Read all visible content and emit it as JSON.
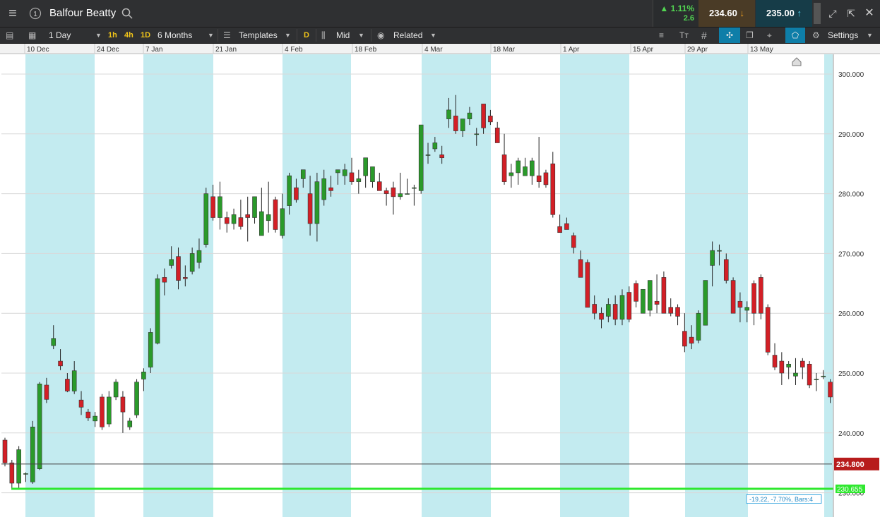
{
  "window": {
    "instrument_title": "Balfour Beatty"
  },
  "quote": {
    "change_pct": "▲ 1.11%",
    "change_pts": "2.6",
    "sell_price": "234.60",
    "buy_price": "235.00"
  },
  "toolbar": {
    "interval": "1 Day",
    "quick_1h": "1h",
    "quick_4h": "4h",
    "quick_1d": "1D",
    "range": "6 Months",
    "templates": "Templates",
    "mode_d": "D",
    "price_type": "Mid",
    "related": "Related",
    "settings": "Settings"
  },
  "colors": {
    "up": "#2a9a2a",
    "down": "#d31f26",
    "shade": "#c3ebf0",
    "current_price_label": "#b71c1c",
    "support_line": "#2ee82e"
  },
  "chart_data": {
    "type": "candlestick",
    "title": "",
    "y_ticks": [
      "300.000",
      "290.000",
      "280.000",
      "270.000",
      "260.000",
      "250.000",
      "240.000",
      "230.000"
    ],
    "ylim": [
      228.5,
      303
    ],
    "x_labels": [
      "10 Dec",
      "24 Dec",
      "7 Jan",
      "21 Jan",
      "4 Feb",
      "18 Feb",
      "4 Mar",
      "18 Mar",
      "1 Apr",
      "15 Apr",
      "29 Apr",
      "13 May"
    ],
    "current_price_label": "234.800",
    "current_price": 234.8,
    "support_label": "230.655",
    "support_value": 230.655,
    "measure_label": "-19.22, -7.70%, Bars:4",
    "measure": {
      "from": 249.6,
      "to": 230.6,
      "bars": 4
    },
    "candles": [
      [
        238.8,
        239.2,
        234.4,
        235.0
      ],
      [
        235.0,
        235.5,
        230.8,
        231.6
      ],
      [
        231.6,
        237.8,
        230.5,
        237.2
      ],
      [
        233.2,
        233.4,
        231.8,
        233.2
      ],
      [
        231.8,
        242.0,
        231.5,
        241.0
      ],
      [
        234.0,
        248.5,
        233.8,
        248.2
      ],
      [
        248.0,
        249.2,
        245.0,
        245.6
      ],
      [
        254.6,
        258.0,
        254.0,
        255.8
      ],
      [
        252.0,
        254.0,
        250.5,
        251.2
      ],
      [
        249.0,
        250.0,
        246.8,
        247.0
      ],
      [
        247.0,
        252.0,
        246.5,
        250.4
      ],
      [
        245.5,
        247.0,
        243.0,
        244.3
      ],
      [
        243.5,
        244.0,
        242.0,
        242.5
      ],
      [
        242.0,
        243.5,
        241.0,
        242.8
      ],
      [
        246.0,
        246.5,
        240.5,
        241.0
      ],
      [
        241.5,
        247.0,
        241.0,
        246.0
      ],
      [
        246.0,
        249.0,
        245.5,
        248.5
      ],
      [
        246.0,
        247.0,
        240.0,
        243.5
      ],
      [
        241.0,
        242.5,
        240.5,
        242.0
      ],
      [
        243.0,
        249.0,
        242.5,
        248.5
      ],
      [
        249.0,
        250.8,
        247.0,
        250.2
      ],
      [
        251.0,
        257.5,
        250.0,
        256.8
      ],
      [
        255.0,
        266.5,
        254.8,
        265.8
      ],
      [
        266.0,
        267.5,
        263.0,
        265.2
      ],
      [
        268.0,
        271.2,
        267.5,
        269.0
      ],
      [
        269.5,
        271.0,
        264.0,
        265.5
      ],
      [
        266.0,
        268.0,
        264.5,
        265.8
      ],
      [
        267.0,
        271.0,
        266.5,
        270.0
      ],
      [
        268.5,
        272.5,
        267.5,
        270.5
      ],
      [
        271.5,
        281.0,
        271.0,
        280.0
      ],
      [
        279.5,
        281.5,
        275.5,
        276.0
      ],
      [
        276.0,
        282.0,
        274.0,
        279.5
      ],
      [
        276.0,
        277.0,
        273.5,
        275.0
      ],
      [
        275.0,
        277.5,
        274.0,
        276.5
      ],
      [
        276.0,
        279.0,
        274.0,
        274.5
      ],
      [
        276.5,
        279.5,
        272.0,
        276.0
      ],
      [
        276.0,
        279.0,
        275.0,
        279.5
      ],
      [
        273.0,
        281.0,
        273.0,
        277.0
      ],
      [
        275.5,
        282.0,
        273.5,
        276.5
      ],
      [
        279.0,
        279.5,
        273.5,
        274.0
      ],
      [
        273.0,
        280.0,
        272.5,
        277.5
      ],
      [
        278.0,
        283.5,
        276.5,
        283.0
      ],
      [
        281.0,
        282.5,
        278.5,
        279.0
      ],
      [
        282.5,
        284.0,
        281.0,
        284.0
      ],
      [
        280.0,
        283.0,
        273.0,
        275.0
      ],
      [
        275.0,
        283.5,
        272.0,
        282.0
      ],
      [
        279.0,
        284.0,
        278.0,
        282.5
      ],
      [
        281.0,
        283.0,
        279.5,
        280.5
      ],
      [
        283.5,
        284.0,
        281.5,
        284.0
      ],
      [
        283.0,
        285.0,
        281.5,
        284.0
      ],
      [
        283.5,
        286.0,
        281.5,
        282.0
      ],
      [
        282.0,
        284.0,
        280.0,
        282.5
      ],
      [
        283.0,
        286.0,
        281.0,
        286.0
      ],
      [
        282.0,
        283.5,
        281.0,
        284.5
      ],
      [
        282.0,
        283.5,
        281.0,
        280.5
      ],
      [
        280.5,
        281.0,
        278.0,
        280.0
      ],
      [
        281.0,
        282.0,
        276.5,
        279.5
      ],
      [
        279.5,
        283.5,
        279.0,
        280.0
      ],
      [
        280.0,
        282.5,
        280.0,
        280.0
      ],
      [
        281.0,
        281.5,
        278.0,
        281.0
      ],
      [
        280.5,
        291.5,
        280.0,
        291.5
      ],
      [
        286.5,
        288.5,
        285.0,
        286.5
      ],
      [
        287.5,
        289.5,
        287.0,
        288.5
      ],
      [
        286.5,
        288.0,
        285.0,
        286.0
      ],
      [
        292.5,
        296.0,
        291.0,
        294.0
      ],
      [
        293.0,
        296.5,
        290.0,
        290.5
      ],
      [
        290.5,
        292.0,
        289.5,
        292.5
      ],
      [
        292.5,
        294.5,
        291.5,
        293.5
      ],
      [
        290.0,
        291.0,
        288.0,
        290.0
      ],
      [
        295.0,
        295.0,
        290.0,
        291.0
      ],
      [
        293.0,
        294.0,
        291.5,
        292.0
      ],
      [
        291.0,
        292.0,
        289.0,
        288.5
      ],
      [
        286.5,
        290.0,
        281.5,
        282.0
      ],
      [
        283.0,
        285.0,
        281.0,
        283.5
      ],
      [
        283.5,
        286.0,
        281.5,
        285.5
      ],
      [
        283.0,
        286.0,
        283.0,
        284.5
      ],
      [
        283.0,
        286.0,
        281.5,
        285.5
      ],
      [
        283.0,
        289.5,
        281.0,
        282.0
      ],
      [
        283.5,
        284.0,
        281.0,
        281.5
      ],
      [
        285.0,
        287.0,
        276.0,
        276.5
      ],
      [
        274.5,
        276.5,
        273.5,
        273.5
      ],
      [
        275.0,
        276.0,
        274.0,
        274.0
      ],
      [
        273.0,
        273.5,
        270.0,
        271.0
      ],
      [
        269.0,
        270.5,
        266.0,
        266.0
      ],
      [
        268.5,
        269.0,
        261.0,
        261.0
      ],
      [
        261.5,
        263.0,
        259.0,
        260.0
      ],
      [
        260.0,
        261.0,
        257.5,
        259.0
      ],
      [
        259.5,
        262.5,
        258.5,
        261.5
      ],
      [
        261.5,
        263.0,
        258.0,
        259.0
      ],
      [
        259.0,
        264.0,
        258.0,
        263.0
      ],
      [
        263.5,
        264.5,
        258.5,
        259.0
      ],
      [
        265.0,
        265.5,
        261.0,
        262.0
      ],
      [
        260.0,
        264.0,
        260.0,
        264.0
      ],
      [
        260.5,
        265.5,
        259.5,
        265.5
      ],
      [
        262.0,
        266.5,
        260.0,
        261.5
      ],
      [
        266.0,
        267.0,
        260.0,
        260.0
      ],
      [
        261.0,
        262.5,
        259.5,
        260.0
      ],
      [
        261.0,
        261.5,
        258.0,
        259.5
      ],
      [
        257.0,
        260.0,
        253.5,
        254.5
      ],
      [
        256.0,
        258.0,
        254.0,
        255.0
      ],
      [
        255.5,
        260.5,
        255.0,
        260.0
      ],
      [
        258.0,
        265.5,
        258.0,
        265.5
      ],
      [
        268.0,
        272.0,
        264.5,
        270.5
      ],
      [
        270.5,
        271.5,
        268.0,
        270.5
      ],
      [
        269.0,
        270.0,
        265.0,
        265.5
      ],
      [
        265.5,
        266.0,
        260.0,
        260.0
      ],
      [
        262.0,
        263.5,
        258.5,
        261.0
      ],
      [
        260.5,
        262.0,
        258.5,
        261.0
      ],
      [
        265.0,
        265.5,
        258.0,
        260.0
      ],
      [
        266.0,
        266.5,
        259.0,
        260.0
      ],
      [
        261.0,
        261.5,
        253.0,
        253.5
      ],
      [
        253.0,
        255.0,
        250.5,
        251.0
      ],
      [
        252.0,
        253.5,
        248.0,
        250.0
      ],
      [
        251.0,
        252.0,
        249.0,
        251.5
      ],
      [
        249.5,
        252.5,
        248.0,
        250.0
      ],
      [
        252.0,
        252.5,
        249.0,
        251.0
      ],
      [
        251.5,
        252.0,
        247.5,
        248.0
      ],
      [
        249.0,
        250.0,
        247.0,
        249.0
      ],
      [
        249.5,
        250.5,
        249.0,
        249.5
      ],
      [
        248.5,
        249.0,
        245.0,
        246.0
      ],
      [
        246.0,
        246.5,
        242.5,
        243.5
      ],
      [
        244.0,
        245.0,
        242.5,
        244.0
      ],
      [
        243.5,
        244.0,
        239.0,
        240.0
      ],
      [
        243.0,
        245.0,
        241.0,
        244.0
      ],
      [
        244.0,
        245.0,
        243.0,
        245.0
      ],
      [
        247.0,
        248.5,
        246.0,
        247.5
      ],
      [
        249.5,
        249.5,
        242.0,
        242.5
      ],
      [
        243.0,
        243.5,
        237.5,
        238.0
      ],
      [
        237.0,
        237.5,
        230.5,
        231.5
      ],
      [
        231.5,
        235.0,
        231.0,
        234.8
      ]
    ]
  }
}
